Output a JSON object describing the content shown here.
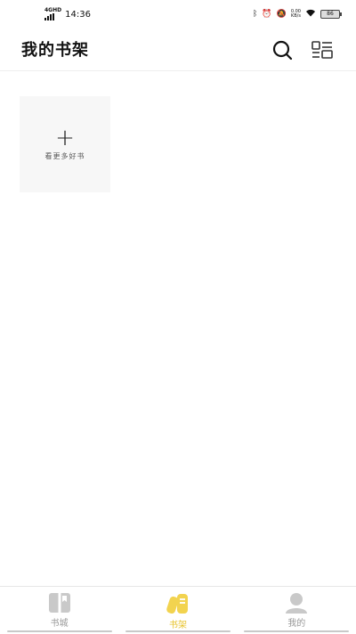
{
  "status_bar": {
    "network": "4G",
    "network_hd": "HD",
    "time": "14:36",
    "speed_value": "0.00",
    "speed_unit": "KB/s",
    "battery": "86"
  },
  "header": {
    "title": "我的书架",
    "search_icon": "search-icon",
    "layout_icon": "list-layout-icon"
  },
  "shelf": {
    "add_label": "看更多好书",
    "add_symbol": "+"
  },
  "bottom_nav": {
    "items": [
      {
        "label": "书城",
        "icon": "bookstore-icon",
        "active": false
      },
      {
        "label": "书架",
        "icon": "bookshelf-icon",
        "active": true
      },
      {
        "label": "我的",
        "icon": "profile-icon",
        "active": false
      }
    ]
  },
  "colors": {
    "accent": "#f2d34f",
    "inactive_icon": "#c9c9c9"
  }
}
